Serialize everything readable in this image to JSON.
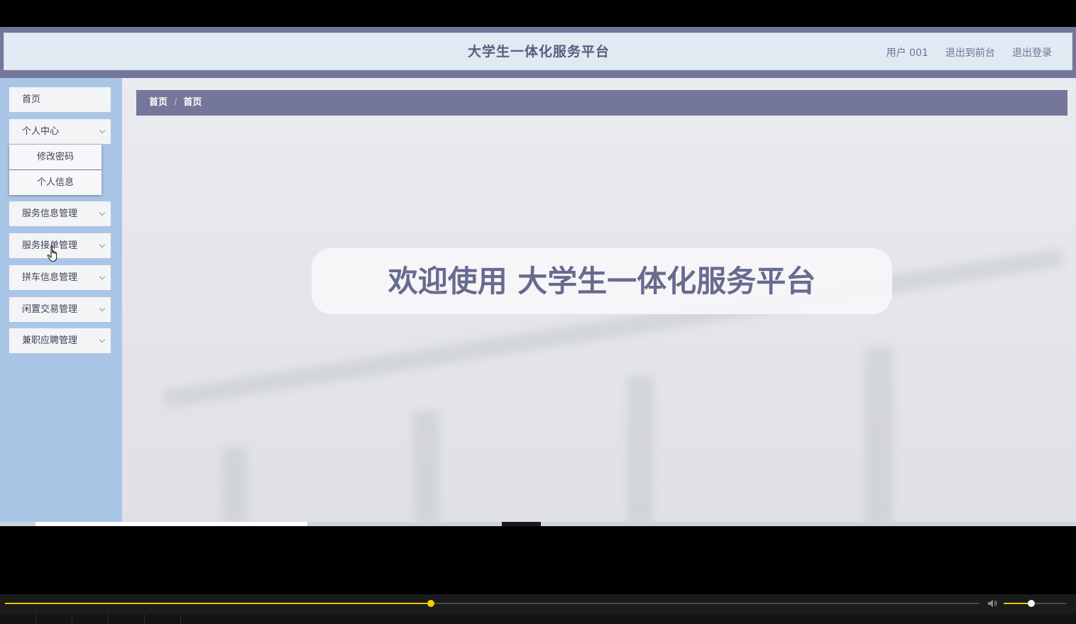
{
  "header": {
    "site_title": "大学生一体化服务平台",
    "user_label": "用户 001",
    "back_to_front": "退出到前台",
    "logout": "退出登录"
  },
  "sidebar": {
    "items": [
      {
        "label": "首页",
        "expandable": false
      },
      {
        "label": "个人中心",
        "expandable": true,
        "expanded": true
      },
      {
        "label": "服务信息管理",
        "expandable": true
      },
      {
        "label": "服务接单管理",
        "expandable": true
      },
      {
        "label": "拼车信息管理",
        "expandable": true
      },
      {
        "label": "闲置交易管理",
        "expandable": true
      },
      {
        "label": "兼职应聘管理",
        "expandable": true
      }
    ],
    "submenu": [
      {
        "label": "修改密码"
      },
      {
        "label": "个人信息"
      }
    ]
  },
  "breadcrumb": {
    "items": [
      "首页",
      "首页"
    ],
    "separator": "/"
  },
  "welcome": {
    "text": "欢迎使用 大学生一体化服务平台"
  },
  "player": {
    "progress": 0.437,
    "volume": 0.44
  },
  "colors": {
    "header_band": "#74769a",
    "header_bg": "#dfeaf3",
    "sidebar_bg": "#aac6e6",
    "breadcrumb_bg": "#74769a",
    "welcome_text": "#676b8f",
    "progress_accent": "#e6c200"
  }
}
